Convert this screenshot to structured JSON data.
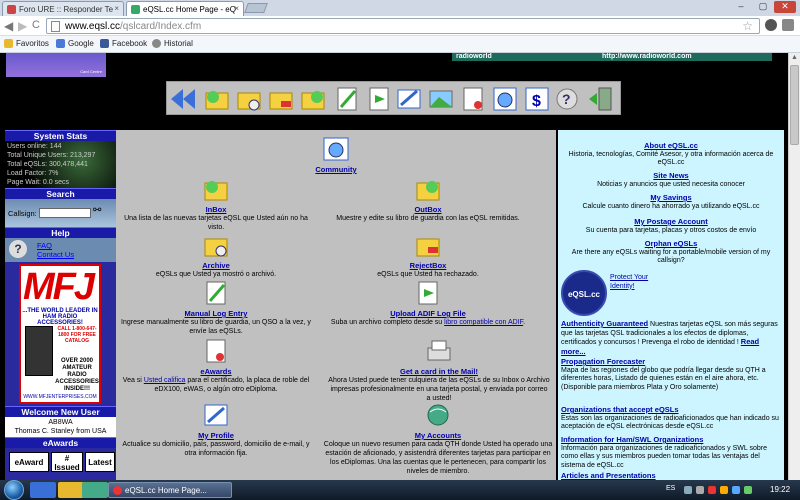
{
  "browser": {
    "tabs": [
      {
        "label": "Foro URE :: Responder Te",
        "close": "×"
      },
      {
        "label": "eQSL.cc Home Page - eQ",
        "close": "×"
      }
    ],
    "window_controls": {
      "minimize": "–",
      "maximize": "▢",
      "close": "✕"
    },
    "nav": {
      "back": "◀",
      "forward": "▶",
      "reload": "C"
    },
    "url_host": "www.eqsl.cc",
    "url_path": "/qslcard/Index.cfm",
    "star": "☆",
    "bookmarks": [
      "Favoritos",
      "Google",
      "Facebook",
      "Historial"
    ]
  },
  "banner": {
    "left_text": "Card Centre",
    "right_text_a": "radioworld",
    "right_text_b": "http://www.radioworld.com"
  },
  "sidebar": {
    "stats_title": "System Stats",
    "stats": [
      "Users online: 144",
      "Total Unique Users: 213,297",
      "Total eQSLs: 300,478,441",
      "Load Factor: 7%",
      "Page Wait: 0.0 secs"
    ],
    "search_title": "Search",
    "callsign_label": "Callsign:",
    "help_title": "Help",
    "help_links": [
      "FAQ",
      "Contact Us"
    ],
    "ad": {
      "logo": "MFJ",
      "tagline": "...THE WORLD LEADER IN HAM RADIO ACCESSORIES!",
      "phone": "CALL 1-800-647-1800 FOR FREE CATALOG",
      "promo": "OVER 2000 AMATEUR RADIO ACCESSORIES INSIDE!!!",
      "url": "WWW.MFJENTERPRISES.COM"
    },
    "welcome_title": "Welcome New User",
    "welcome_call": "AB8WA",
    "welcome_name": "Thomas C. Stanley from USA",
    "eawards_title": "eAwards",
    "eawards_buttons": [
      "eAward",
      "# Issued",
      "Latest"
    ]
  },
  "main": {
    "community": "Community",
    "items": [
      {
        "title": "InBox",
        "desc": "Una lista de las nuevas tarjetas eQSL que Usted aún no ha visto."
      },
      {
        "title": "OutBox",
        "desc": "Muestre y edite su libro de guardia con las eQSL remitidas."
      },
      {
        "title": "Archive",
        "desc": "eQSLs que Usted ya mostró o archivó."
      },
      {
        "title": "RejectBox",
        "desc": "eQSLs que Usted ha rechazado."
      },
      {
        "title": "Manual Log Entry",
        "desc": "Ingrese manualmente su libro de guardia, un QSO a la vez, y envíe las eQSLs."
      },
      {
        "title": "Upload ADIF Log File",
        "desc_a": "Suba un archivo completo desde su ",
        "desc_link": "libro compatible con ADIF",
        "desc_b": "."
      },
      {
        "title": "eAwards",
        "desc_a": "Vea si ",
        "desc_link": "Usted califica",
        "desc_b": " para el certificado, la placa de roble del eDX100, eWAS, o algún otro eDiploma."
      },
      {
        "title": "Get a card in the Mail!",
        "desc": "Ahora Usted puede tener culquiera de las eQSLs de su Inbox o Archivo impresas profesionalmente en una tarjeta postal, y enviada por correo a usted!"
      },
      {
        "title": "My Profile",
        "desc": "Actualice su domicilio, país, password, domicilio de e-mail, y otra información fija."
      },
      {
        "title": "My Accounts",
        "desc": "Coloque un nuevo resumen para cada QTH donde Usted ha operado una estación de aficionado, y asistendrá diferentes tarjetas para participar en los eDiplomas. Una las cuentas que le pertenecen, para compartir los niveles de miembro."
      }
    ]
  },
  "right": {
    "about_title": "About eQSL.cc",
    "about_desc": "Historia, tecnologías, Comité Asesor, y otra información acerca de eQSL.cc",
    "news_title": "Site News",
    "news_desc": "Noticias y anuncios que usted necesita conocer",
    "savings_title": "My Savings",
    "savings_desc": "Calcule cuanto dinero ha ahorrado ya utilizando eQSL.cc",
    "postage_title": "My Postage Account",
    "postage_desc": "Su cuenta para tarjetas, placas y otros costos de envío",
    "orphan_title": "Orphan eQSLs",
    "orphan_desc": "Are there any eQSLs waiting for a portable/mobile version of my callsign?",
    "seal_text": "eQSL.cc",
    "protect": "Protect Your Identity!",
    "auth_title": "Authenticity Guaranteed",
    "auth_desc": " Nuestras tarjetas eQSL son más seguras que las tarjetas QSL tradicionales a los efectos de diplomas, certificados y concursos ! Prevenga el robo de identidad ! ",
    "auth_more": "Read more...",
    "prop_title": "Propagation Forecaster",
    "prop_desc": "Mapa de las regiones del globo que podría llegar desde su QTH a diferentes horas, Listado de quienes están en el aire ahora, etc. (Disponible para miembros Plata y Oro solamente)",
    "orgs_title": "Organizations that accept eQSLs",
    "orgs_desc": "Estas son las organizaciones de radioaficionados que han indicado su aceptación de eQSL electrónicas desde eQSL.cc",
    "ham_title": "Information for Ham/SWL Organizations",
    "ham_desc": "Información para organizaciones de radioaficionados y SWL sobre como ellas y sus miembros pueden tomar todas las ventajas del sistema de eQSL.cc",
    "articles_title": "Articles and Presentations"
  },
  "taskbar": {
    "task_label": "eQSL.cc Home Page...",
    "lang": "ES",
    "clock": "19:22"
  }
}
